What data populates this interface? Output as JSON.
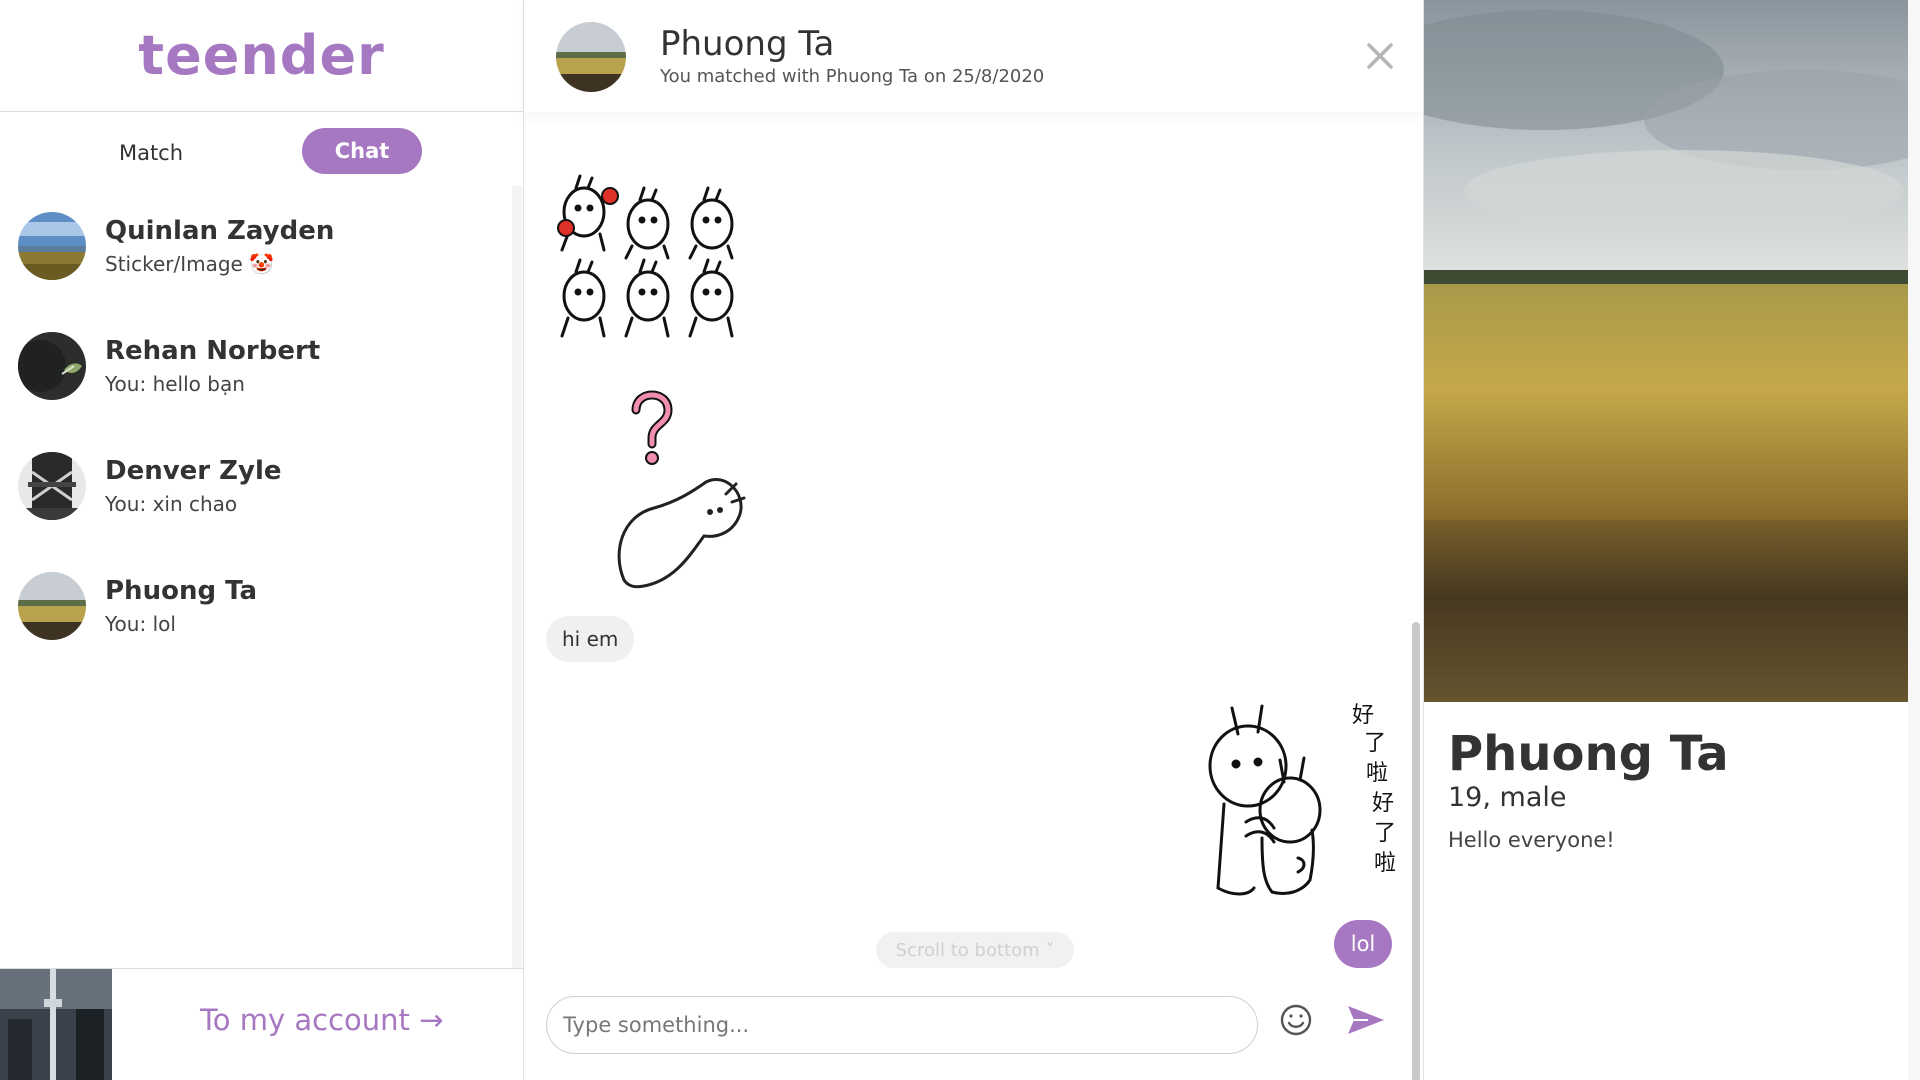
{
  "app": {
    "logo": "teender"
  },
  "colors": {
    "accent": "#a678c2"
  },
  "sidebar": {
    "tabs": [
      {
        "label": "Match",
        "active": false
      },
      {
        "label": "Chat",
        "active": true
      }
    ],
    "conversations": [
      {
        "name": "Quinlan Zayden",
        "last": "Sticker/Image 🤡",
        "avatar": "landscape-avatar"
      },
      {
        "name": "Rehan Norbert",
        "last": "You: hello bạn",
        "avatar": "dark-leaf-avatar"
      },
      {
        "name": "Denver Zyle",
        "last": "You: xin chao",
        "avatar": "tower-avatar"
      },
      {
        "name": "Phuong Ta",
        "last": "You: lol",
        "avatar": "field-avatar"
      }
    ],
    "account_link": "To my account →"
  },
  "chat": {
    "header": {
      "name": "Phuong Ta",
      "subtitle": "You matched with Phuong Ta on 25/8/2020"
    },
    "messages": [
      {
        "from": "them",
        "type": "sticker",
        "sticker": "six-bunnies-sticker"
      },
      {
        "from": "them",
        "type": "sticker",
        "sticker": "confused-bunny-sticker"
      },
      {
        "from": "them",
        "type": "text",
        "text": "hi em"
      },
      {
        "from": "me",
        "type": "sticker",
        "sticker": "hugging-bunnies-sticker"
      },
      {
        "from": "me",
        "type": "text",
        "text": "lol"
      }
    ],
    "scroll_to_bottom": "Scroll to bottom ˅",
    "composer": {
      "placeholder": "Type something...",
      "value": ""
    }
  },
  "profile": {
    "name": "Phuong Ta",
    "age_gender": "19, male",
    "bio": "Hello everyone!"
  }
}
